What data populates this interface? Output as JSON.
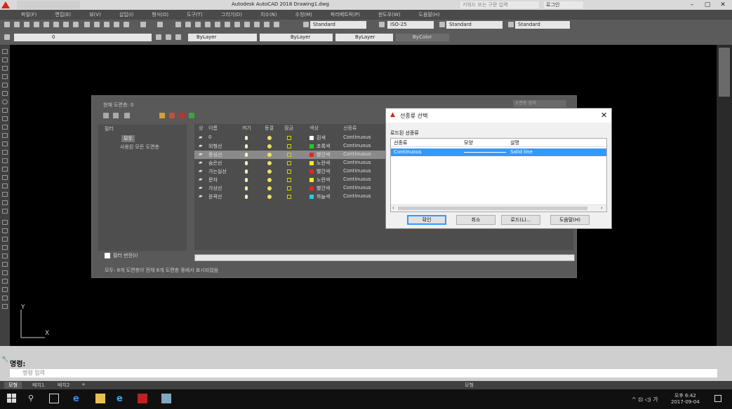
{
  "window": {
    "title": "Autodesk AutoCAD 2018    Drawing1.dwg",
    "search_placeholder": "키워드 또는 구문 입력",
    "sign_in": "로그인"
  },
  "menubar": [
    "파일(F)",
    "편집(E)",
    "뷰(V)",
    "삽입(I)",
    "형식(O)",
    "도구(T)",
    "그리기(D)",
    "치수(N)",
    "수정(M)",
    "파라메트릭(P)",
    "윈도우(W)",
    "도움말(H)"
  ],
  "toolbar": {
    "text_style": "Standard",
    "dim_style": "ISO-25",
    "table_style": "Standard",
    "mleader_style": "Standard",
    "layer_current": "0",
    "color": "ByLayer",
    "linetype": "ByLayer",
    "lineweight": "ByLayer",
    "plotstyle": "ByColor"
  },
  "layer_manager": {
    "title": "현재 도면층: 0",
    "search_placeholder": "도면층 검색",
    "filter_header": "필터",
    "filter_all": "모두",
    "filter_used": "사용된 모든 도면층",
    "columns": [
      "상",
      "이름",
      "켜기",
      "동결",
      "잠금",
      "색상",
      "선종류"
    ],
    "layers": [
      {
        "name": "0",
        "color_name": "흰색",
        "color_hex": "#ffffff",
        "linetype": "Continuous"
      },
      {
        "name": "외형선",
        "color_name": "초록색",
        "color_hex": "#22cc22",
        "linetype": "Continuous"
      },
      {
        "name": "중심선",
        "color_name": "빨간색",
        "color_hex": "#ee2222",
        "linetype": "Continuous"
      },
      {
        "name": "숨은선",
        "color_name": "노란색",
        "color_hex": "#eeee22",
        "linetype": "Continuous"
      },
      {
        "name": "가는실선",
        "color_name": "빨간색",
        "color_hex": "#ee2222",
        "linetype": "Continuous"
      },
      {
        "name": "문자",
        "color_name": "노란색",
        "color_hex": "#eeee22",
        "linetype": "Continuous"
      },
      {
        "name": "가상선",
        "color_name": "빨간색",
        "color_hex": "#ee2222",
        "linetype": "Continuous"
      },
      {
        "name": "윤곽선",
        "color_name": "하늘색",
        "color_hex": "#22ccee",
        "linetype": "Continuous"
      }
    ],
    "selected_index": 2,
    "invert_filter": "필터 반전(I)",
    "status": "모두: 8개 도면층이 전체 8개 도면층 중에서 표시되었음"
  },
  "linetype_dialog": {
    "title": "선종류 선택",
    "loaded_label": "로드된 선종류",
    "columns": [
      "선종류",
      "모양",
      "설명"
    ],
    "rows": [
      {
        "name": "Continuous",
        "desc": "Solid line"
      }
    ],
    "buttons": [
      "확인",
      "취소",
      "로드(L)...",
      "도움말(H)"
    ]
  },
  "command": {
    "history": "명령:",
    "placeholder": "명령 입력"
  },
  "layout_tabs": [
    "모형",
    "배치1",
    "배치2"
  ],
  "status_model": "모형",
  "clock": {
    "time": "오후 6:42",
    "date": "2017-09-04"
  },
  "ucs": {
    "x": "X",
    "y": "Y"
  }
}
